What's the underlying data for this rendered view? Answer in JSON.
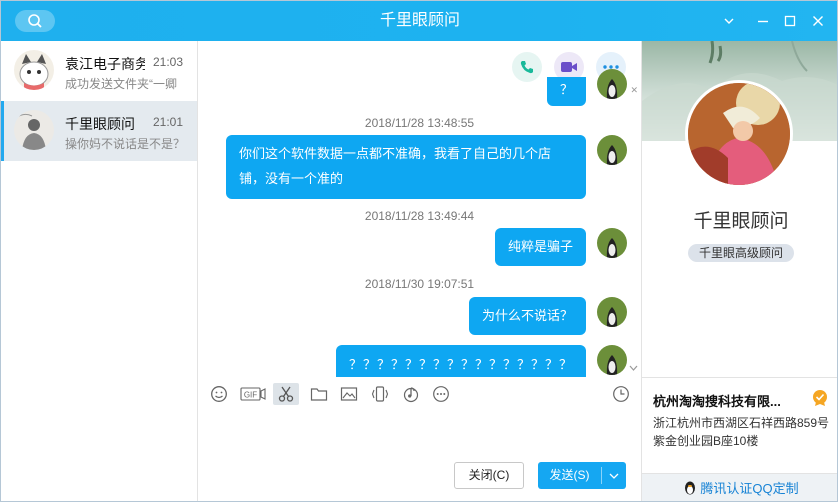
{
  "window": {
    "title": "千里眼顾问"
  },
  "conversations": [
    {
      "name": "袁江电子商务",
      "time": "21:03",
      "preview": "成功发送文件夹“一卿"
    },
    {
      "name": "千里眼顾问",
      "time": "21:01",
      "preview": "操你妈不说话是不是？"
    }
  ],
  "messages": {
    "partial_top": "？",
    "ts1": "2018/11/28 13:48:55",
    "m1_line1": "你们这个软件数据一点都不准确，我看了自己的几个店",
    "m1_line2": "铺，没有一个准的",
    "ts2": "2018/11/28 13:49:44",
    "m2": "纯粹是骗子",
    "ts3": "2018/11/30 19:07:51",
    "m3": "为什么不说话？",
    "m4": "？？？？？？？？？？？？？？？？"
  },
  "toolbar": {
    "gif": "GIF"
  },
  "buttons": {
    "close": "关闭(C)",
    "send": "发送(S)"
  },
  "profile": {
    "name": "千里眼顾问",
    "tag": "千里眼高级顾问",
    "company": "杭州淘淘搜科技有限...",
    "address": "浙江杭州市西湖区石祥西路859号紫金创业园B座10楼",
    "footer": "腾讯认证QQ定制"
  },
  "colors": {
    "accent": "#15a7f2",
    "titlebar": "#1fb0ee",
    "badge": "#f5a623"
  }
}
